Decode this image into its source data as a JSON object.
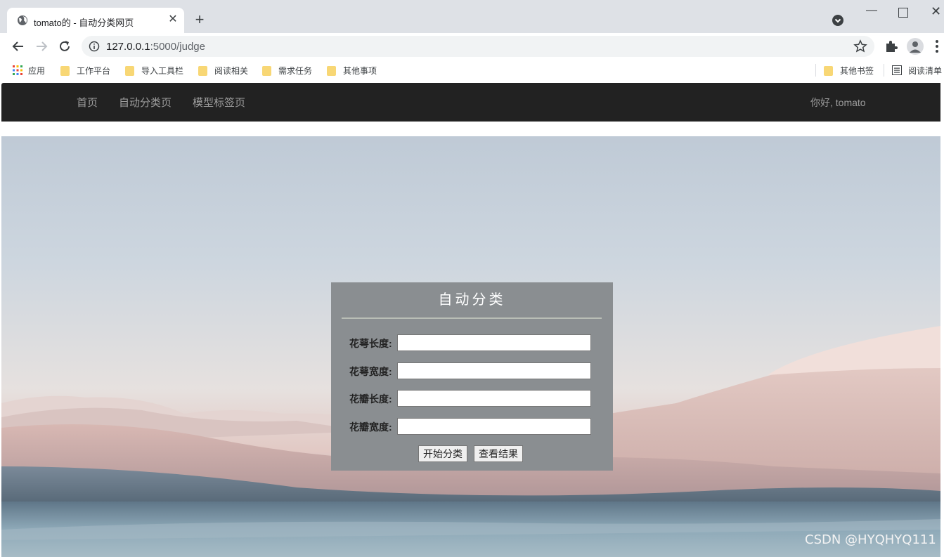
{
  "browser": {
    "tab_title": "tomato的 - 自动分类网页",
    "url_host": "127.0.0.1",
    "url_path": ":5000/judge",
    "bookmarks": [
      {
        "label": "应用"
      },
      {
        "label": "工作平台"
      },
      {
        "label": "导入工具栏"
      },
      {
        "label": "阅读相关"
      },
      {
        "label": "需求任务"
      },
      {
        "label": "其他事项"
      }
    ],
    "other_bookmarks": "其他书签",
    "reading_list": "阅读清单"
  },
  "navbar": {
    "links": [
      {
        "label": "首页"
      },
      {
        "label": "自动分类页"
      },
      {
        "label": "模型标签页"
      }
    ],
    "greeting": "你好, tomato"
  },
  "form": {
    "title": "自动分类",
    "fields": [
      {
        "label": "花萼长度:",
        "value": ""
      },
      {
        "label": "花萼宽度:",
        "value": ""
      },
      {
        "label": "花瓣长度:",
        "value": ""
      },
      {
        "label": "花瓣宽度:",
        "value": ""
      }
    ],
    "submit_label": "开始分类",
    "result_label": "查看结果"
  },
  "watermark": "CSDN @HYQHYQ111"
}
